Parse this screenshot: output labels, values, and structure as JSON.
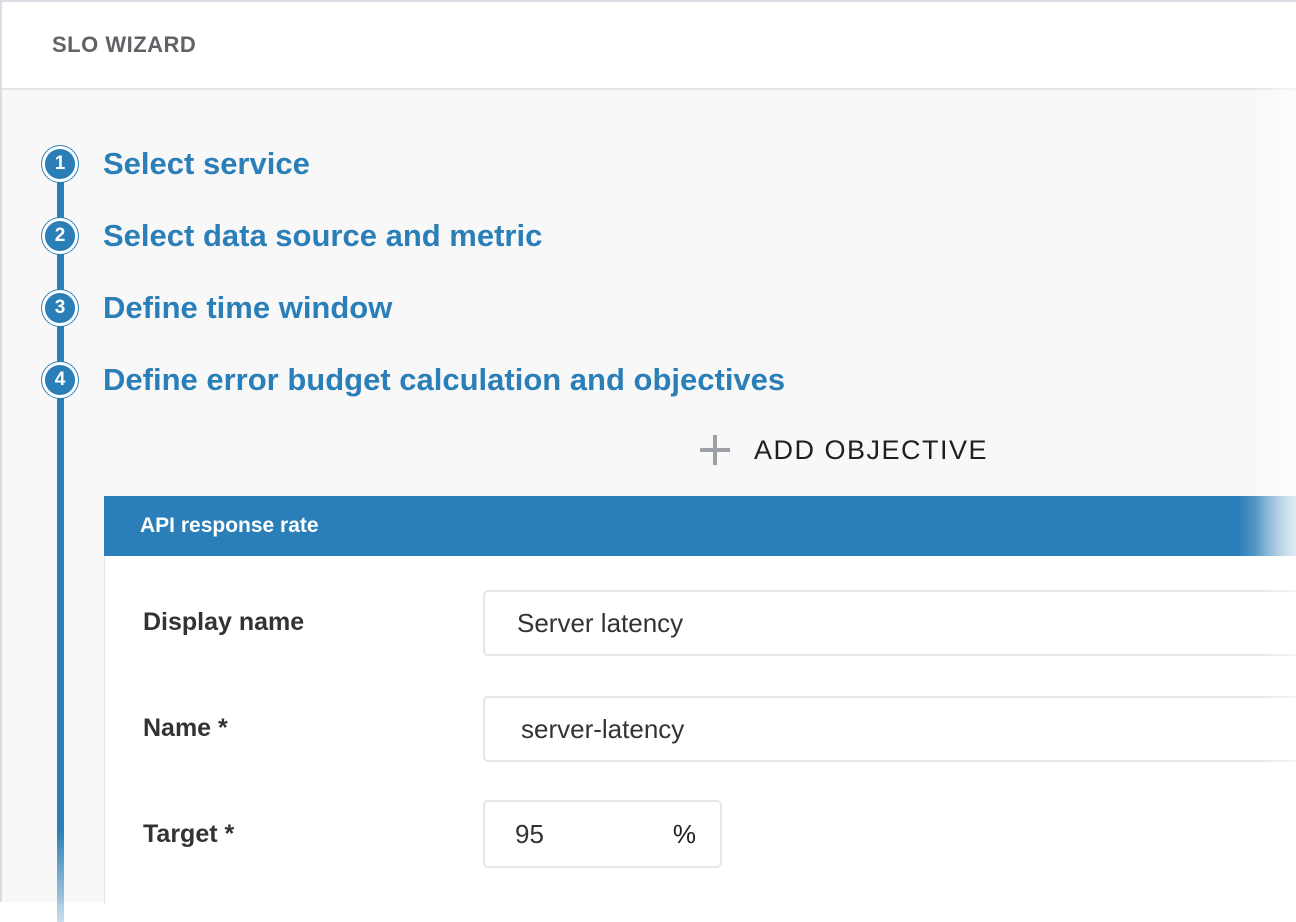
{
  "header": {
    "title": "SLO WIZARD"
  },
  "steps": [
    {
      "number": "1",
      "label": "Select service"
    },
    {
      "number": "2",
      "label": "Select data source and metric"
    },
    {
      "number": "3",
      "label": "Define time window"
    },
    {
      "number": "4",
      "label": "Define error budget calculation and objectives"
    }
  ],
  "objectives": {
    "add_label": "ADD OBJECTIVE",
    "add_icon": "plus-icon"
  },
  "objective_panel": {
    "title": "API response rate",
    "fields": {
      "display_name": {
        "label": "Display name",
        "value": "Server latency"
      },
      "name": {
        "label": "Name *",
        "value": "server-latency"
      },
      "target": {
        "label": "Target *",
        "value": "95",
        "unit": "%"
      }
    }
  }
}
